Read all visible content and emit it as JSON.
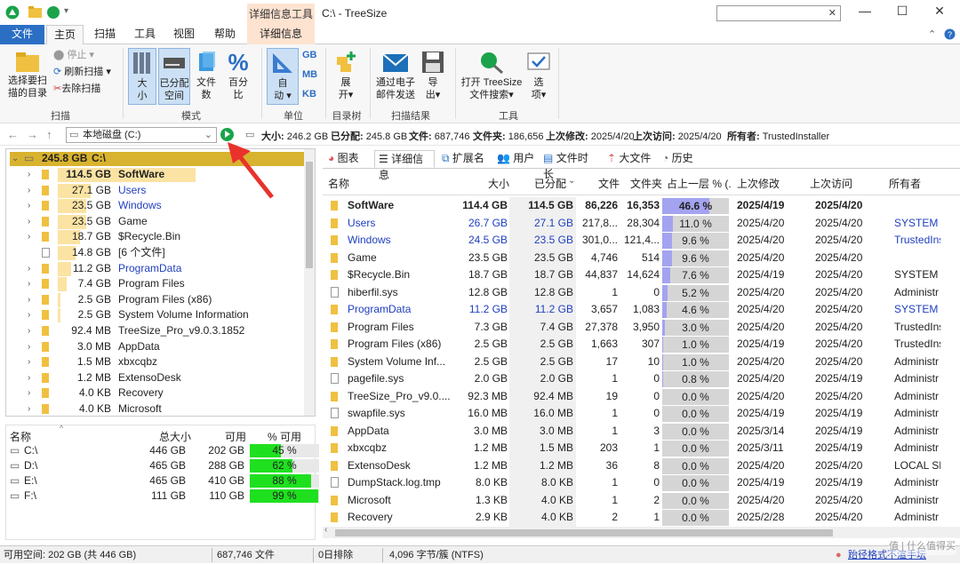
{
  "window": {
    "title": "C:\\ - TreeSize",
    "context_tab_header": "详细信息工具"
  },
  "ribbon_tabs": [
    "文件",
    "主页",
    "扫描",
    "工具",
    "视图",
    "帮助",
    "详细信息"
  ],
  "ribbon": {
    "select_dir": "选择要扫\n描的目录",
    "stop": "停止",
    "refresh": "刷新扫描",
    "remove": "去除扫描",
    "group_scan": "扫描",
    "size": "大\n小",
    "allocated": "已分配\n空间",
    "files": "文件\n数",
    "percent": "百分\n比",
    "group_mode": "模式",
    "auto": "自\n动",
    "units": [
      "GB",
      "MB",
      "KB"
    ],
    "group_unit": "单位",
    "expand": "展\n开",
    "group_tree": "目录树",
    "email": "通过电子\n邮件发送",
    "export": "导\n出",
    "group_results": "扫描结果",
    "open_treesize": "打开 TreeSize\n文件搜索",
    "options": "选\n项",
    "group_tools": "工具"
  },
  "addressbar": {
    "drive": "本地磁盘 (C:)",
    "size_label": "大小:",
    "size": "246.2 GB",
    "alloc_label": "已分配:",
    "alloc": "245.8 GB",
    "files_label": "文件:",
    "files": "687,746",
    "folders_label": "文件夹:",
    "folders": "186,656",
    "modified_label": "上次修改:",
    "modified": "2025/4/20",
    "accessed_label": "上次访问:",
    "accessed": "2025/4/20",
    "owner_label": "所有者:",
    "owner": "TrustedInstaller"
  },
  "tree": {
    "root_size": "245.8 GB",
    "root_name": "C:\\",
    "items": [
      {
        "size": "114.5 GB",
        "name": "SoftWare",
        "bar": 0.466,
        "bold": true,
        "chev": true
      },
      {
        "size": "27.1 GB",
        "name": "Users",
        "bar": 0.11,
        "blue": true,
        "chev": true
      },
      {
        "size": "23.5 GB",
        "name": "Windows",
        "bar": 0.096,
        "blue": true,
        "chev": true
      },
      {
        "size": "23.5 GB",
        "name": "Game",
        "bar": 0.096,
        "chev": true
      },
      {
        "size": "18.7 GB",
        "name": "$Recycle.Bin",
        "bar": 0.076,
        "chev": true
      },
      {
        "size": "14.8 GB",
        "name": "[6 个文件]",
        "bar": 0.06,
        "file": true
      },
      {
        "size": "11.2 GB",
        "name": "ProgramData",
        "bar": 0.046,
        "blue": true,
        "chev": true
      },
      {
        "size": "7.4 GB",
        "name": "Program Files",
        "bar": 0.03,
        "chev": true
      },
      {
        "size": "2.5 GB",
        "name": "Program Files (x86)",
        "bar": 0.01,
        "chev": true
      },
      {
        "size": "2.5 GB",
        "name": "System Volume Information",
        "bar": 0.01,
        "chev": true
      },
      {
        "size": "92.4 MB",
        "name": "TreeSize_Pro_v9.0.3.1852",
        "bar": 0,
        "chev": true
      },
      {
        "size": "3.0 MB",
        "name": "AppData",
        "bar": 0,
        "chev": true
      },
      {
        "size": "1.5 MB",
        "name": "xbxcqbz",
        "bar": 0,
        "chev": true
      },
      {
        "size": "1.2 MB",
        "name": "ExtensoDesk",
        "bar": 0,
        "chev": true
      },
      {
        "size": "4.0 KB",
        "name": "Recovery",
        "bar": 0,
        "chev": true
      },
      {
        "size": "4.0 KB",
        "name": "Microsoft",
        "bar": 0,
        "chev": true
      }
    ]
  },
  "drives": {
    "headers": [
      "名称",
      "总大小",
      "可用",
      "% 可用"
    ],
    "rows": [
      {
        "name": "C:\\",
        "total": "446 GB",
        "free": "202 GB",
        "pct_label": "45 %",
        "pct": 0.45
      },
      {
        "name": "D:\\",
        "total": "465 GB",
        "free": "288 GB",
        "pct_label": "62 %",
        "pct": 0.62
      },
      {
        "name": "E:\\",
        "total": "465 GB",
        "free": "410 GB",
        "pct_label": "88 %",
        "pct": 0.88
      },
      {
        "name": "F:\\",
        "total": "111 GB",
        "free": "110 GB",
        "pct_label": "99 %",
        "pct": 0.99
      }
    ]
  },
  "view_tabs": [
    "图表",
    "详细信息",
    "扩展名",
    "用户",
    "文件时长",
    "大文件",
    "历史"
  ],
  "grid": {
    "headers": [
      "名称",
      "大小",
      "已分配",
      "文件",
      "文件夹",
      "占上一层 % (...",
      "上次修改",
      "上次访问",
      "所有者"
    ],
    "rows": [
      {
        "name": "SoftWare",
        "size": "114.4 GB",
        "alloc": "114.5 GB",
        "files": "86,226",
        "folders": "16,353",
        "pct_label": "46.6 %",
        "pct": 0.466,
        "mod": "2025/4/19",
        "acc": "2025/4/20",
        "owner": "",
        "bold": true,
        "type": "folder"
      },
      {
        "name": "Users",
        "size": "26.7 GB",
        "alloc": "27.1 GB",
        "files": "217,8...",
        "folders": "28,304",
        "pct_label": "11.0 %",
        "pct": 0.11,
        "mod": "2025/4/20",
        "acc": "2025/4/20",
        "owner": "SYSTEM",
        "blue": true,
        "type": "folder"
      },
      {
        "name": "Windows",
        "size": "24.5 GB",
        "alloc": "23.5 GB",
        "files": "301,0...",
        "folders": "121,4...",
        "pct_label": "9.6 %",
        "pct": 0.096,
        "mod": "2025/4/20",
        "acc": "2025/4/20",
        "owner": "TrustedIns",
        "blue": true,
        "type": "folder"
      },
      {
        "name": "Game",
        "size": "23.5 GB",
        "alloc": "23.5 GB",
        "files": "4,746",
        "folders": "514",
        "pct_label": "9.6 %",
        "pct": 0.096,
        "mod": "2025/4/20",
        "acc": "2025/4/20",
        "owner": "",
        "type": "folder"
      },
      {
        "name": "$Recycle.Bin",
        "size": "18.7 GB",
        "alloc": "18.7 GB",
        "files": "44,837",
        "folders": "14,624",
        "pct_label": "7.6 %",
        "pct": 0.076,
        "mod": "2025/4/19",
        "acc": "2025/4/20",
        "owner": "SYSTEM",
        "type": "folder"
      },
      {
        "name": "hiberfil.sys",
        "size": "12.8 GB",
        "alloc": "12.8 GB",
        "files": "1",
        "folders": "0",
        "pct_label": "5.2 %",
        "pct": 0.052,
        "mod": "2025/4/20",
        "acc": "2025/4/20",
        "owner": "Administr",
        "type": "file"
      },
      {
        "name": "ProgramData",
        "size": "11.2 GB",
        "alloc": "11.2 GB",
        "files": "3,657",
        "folders": "1,083",
        "pct_label": "4.6 %",
        "pct": 0.046,
        "mod": "2025/4/20",
        "acc": "2025/4/20",
        "owner": "SYSTEM",
        "blue": true,
        "type": "folder"
      },
      {
        "name": "Program Files",
        "size": "7.3 GB",
        "alloc": "7.4 GB",
        "files": "27,378",
        "folders": "3,950",
        "pct_label": "3.0 %",
        "pct": 0.03,
        "mod": "2025/4/20",
        "acc": "2025/4/20",
        "owner": "TrustedIns",
        "type": "folder"
      },
      {
        "name": "Program Files (x86)",
        "size": "2.5 GB",
        "alloc": "2.5 GB",
        "files": "1,663",
        "folders": "307",
        "pct_label": "1.0 %",
        "pct": 0.01,
        "mod": "2025/4/19",
        "acc": "2025/4/20",
        "owner": "TrustedIns",
        "type": "folder"
      },
      {
        "name": "System Volume Inf...",
        "size": "2.5 GB",
        "alloc": "2.5 GB",
        "files": "17",
        "folders": "10",
        "pct_label": "1.0 %",
        "pct": 0.01,
        "mod": "2025/4/20",
        "acc": "2025/4/20",
        "owner": "Administr",
        "type": "folder"
      },
      {
        "name": "pagefile.sys",
        "size": "2.0 GB",
        "alloc": "2.0 GB",
        "files": "1",
        "folders": "0",
        "pct_label": "0.8 %",
        "pct": 0.008,
        "mod": "2025/4/20",
        "acc": "2025/4/19",
        "owner": "Administr",
        "type": "file"
      },
      {
        "name": "TreeSize_Pro_v9.0....",
        "size": "92.3 MB",
        "alloc": "92.4 MB",
        "files": "19",
        "folders": "0",
        "pct_label": "0.0 %",
        "pct": 0,
        "mod": "2025/4/20",
        "acc": "2025/4/20",
        "owner": "Administr",
        "type": "folder"
      },
      {
        "name": "swapfile.sys",
        "size": "16.0 MB",
        "alloc": "16.0 MB",
        "files": "1",
        "folders": "0",
        "pct_label": "0.0 %",
        "pct": 0,
        "mod": "2025/4/19",
        "acc": "2025/4/19",
        "owner": "Administr",
        "type": "file"
      },
      {
        "name": "AppData",
        "size": "3.0 MB",
        "alloc": "3.0 MB",
        "files": "1",
        "folders": "3",
        "pct_label": "0.0 %",
        "pct": 0,
        "mod": "2025/3/14",
        "acc": "2025/4/19",
        "owner": "Administr",
        "type": "folder"
      },
      {
        "name": "xbxcqbz",
        "size": "1.2 MB",
        "alloc": "1.5 MB",
        "files": "203",
        "folders": "1",
        "pct_label": "0.0 %",
        "pct": 0,
        "mod": "2025/3/11",
        "acc": "2025/4/19",
        "owner": "Administr",
        "type": "folder"
      },
      {
        "name": "ExtensoDesk",
        "size": "1.2 MB",
        "alloc": "1.2 MB",
        "files": "36",
        "folders": "8",
        "pct_label": "0.0 %",
        "pct": 0,
        "mod": "2025/4/20",
        "acc": "2025/4/20",
        "owner": "LOCAL SEI",
        "type": "folder"
      },
      {
        "name": "DumpStack.log.tmp",
        "size": "8.0 KB",
        "alloc": "8.0 KB",
        "files": "1",
        "folders": "0",
        "pct_label": "0.0 %",
        "pct": 0,
        "mod": "2025/4/19",
        "acc": "2025/4/19",
        "owner": "Administr",
        "type": "file"
      },
      {
        "name": "Microsoft",
        "size": "1.3 KB",
        "alloc": "4.0 KB",
        "files": "1",
        "folders": "2",
        "pct_label": "0.0 %",
        "pct": 0,
        "mod": "2025/4/20",
        "acc": "2025/4/20",
        "owner": "Administr",
        "type": "folder"
      },
      {
        "name": "Recovery",
        "size": "2.9 KB",
        "alloc": "4.0 KB",
        "files": "2",
        "folders": "1",
        "pct_label": "0.0 %",
        "pct": 0,
        "mod": "2025/2/28",
        "acc": "2025/4/20",
        "owner": "Administr",
        "type": "folder"
      }
    ]
  },
  "statusbar": {
    "free": "可用空间: 202 GB (共 446 GB)",
    "files": "687,746 文件",
    "excluded": "0日排除",
    "cluster": "4,096 字节/簇 (NTFS)",
    "link": "跆径格式不渲手坛",
    "watermark": "值 | 什么值得买"
  },
  "colors": {
    "accent": "#2b6fc4",
    "tree_bar": "#fbe3a3",
    "root_bar": "#d8b32f",
    "pct_bar": "#a3a3f0",
    "free_bar": "#1fe01f",
    "arrow": "#e8322b"
  }
}
